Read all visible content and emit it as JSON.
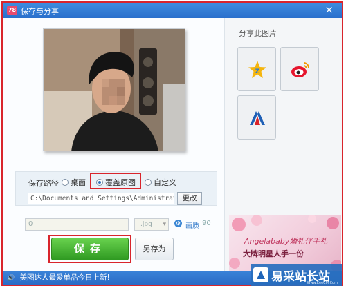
{
  "window": {
    "title": "保存与分享",
    "app_icon_text": "78",
    "close_glyph": "×"
  },
  "save_path": {
    "label": "保存路径",
    "options": [
      {
        "label": "桌面",
        "selected": false
      },
      {
        "label": "覆盖原图",
        "selected": true
      },
      {
        "label": "自定义",
        "selected": false
      }
    ],
    "path_value": "C:\\Documents and Settings\\Administrator\\桌",
    "change_label": "更改"
  },
  "output": {
    "size_value": "0",
    "format_value": ".jpg",
    "quality_label": "画质",
    "quality_value": "90"
  },
  "buttons": {
    "save_label": "保存",
    "save_as_label": "另存为"
  },
  "share": {
    "title": "分享此图片",
    "targets": [
      "qzone-icon",
      "weibo-icon",
      "renren-icon"
    ]
  },
  "ad": {
    "line1": "Angelababy婚礼伴手礼",
    "line2": "大牌明星人手一份"
  },
  "status": {
    "message": "美图达人最爱单品今日上新!"
  },
  "watermark": {
    "text": "易采站长站",
    "sub": "Www.EeeCM.Com"
  },
  "colors": {
    "highlight": "#d9252c",
    "titlebar": "#2a6fcc",
    "save_green": "#3aa82a"
  }
}
